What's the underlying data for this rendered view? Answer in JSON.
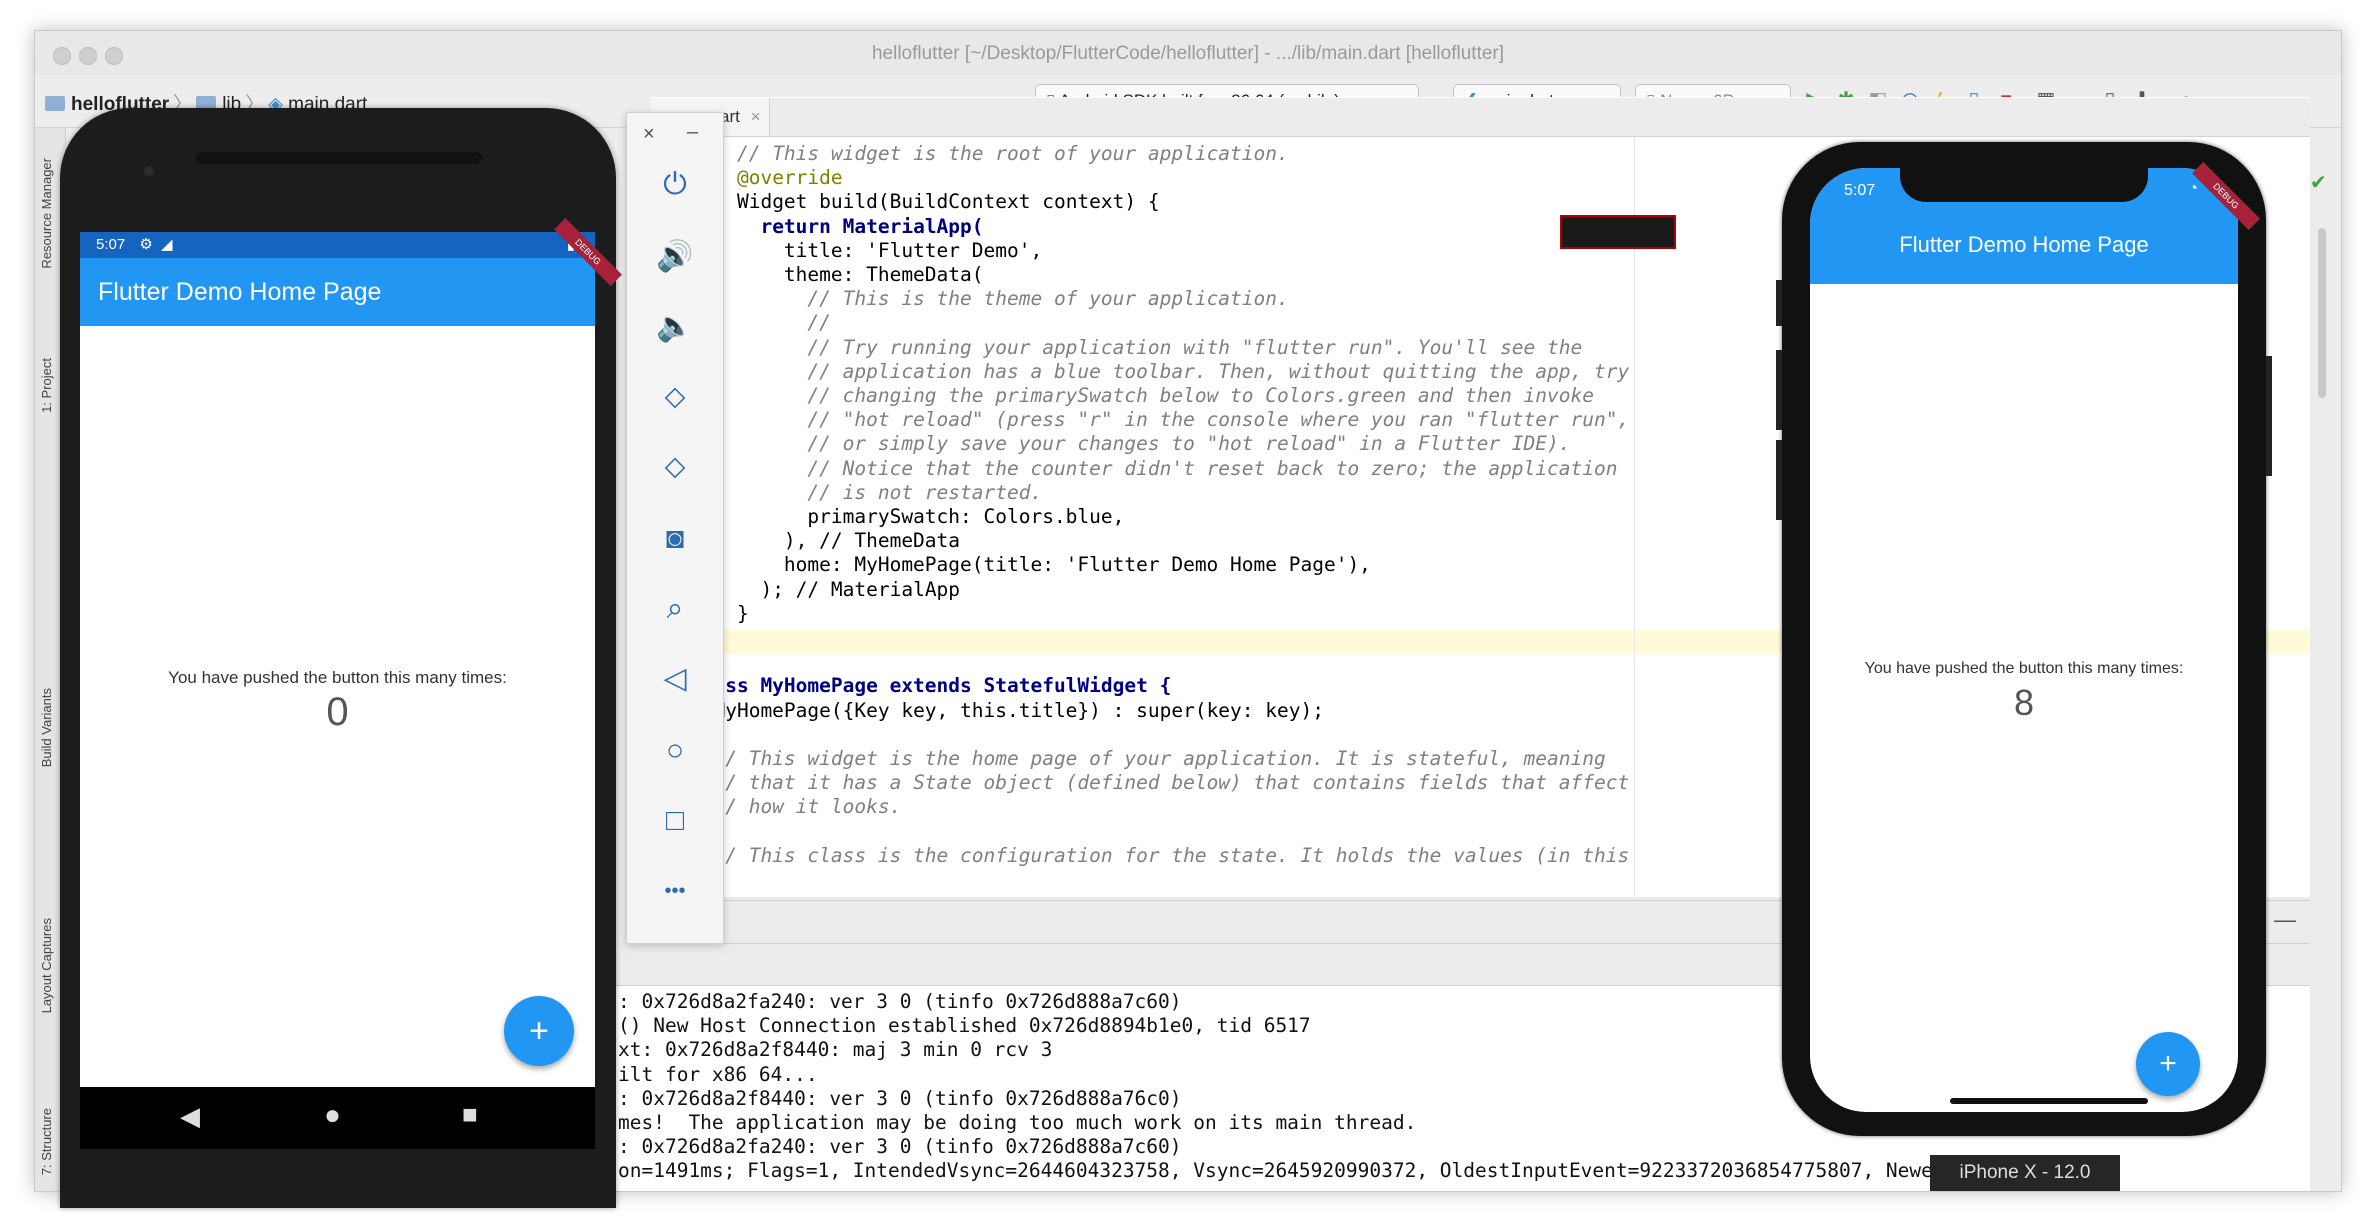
{
  "window": {
    "title": "helloflutter [~/Desktop/FlutterCode/helloflutter] - .../lib/main.dart [helloflutter]"
  },
  "breadcrumb": {
    "project": "helloflutter",
    "folder": "lib",
    "file": "main.dart"
  },
  "toolbar": {
    "device_selector": "Android SDK built for x86 64 (mobile)",
    "run_config": "main.dart",
    "avd_selector": "Nexus 6P"
  },
  "editor": {
    "tab_label": "art",
    "code_lines": [
      "// This widget is the root of your application.",
      "@override",
      "Widget build(BuildContext context) {",
      "return MaterialApp(",
      "title: 'Flutter Demo',",
      "theme: ThemeData(",
      "// This is the theme of your application.",
      "//",
      "// Try running your application with \"flutter run\". You'll see the",
      "// application has a blue toolbar. Then, without quitting the app, try",
      "// changing the primarySwatch below to Colors.green and then invoke",
      "// \"hot reload\" (press \"r\" in the console where you ran \"flutter run\",",
      "// or simply save your changes to \"hot reload\" in a Flutter IDE).",
      "// Notice that the counter didn't reset back to zero; the application",
      "// is not restarted.",
      "primarySwatch: Colors.blue,",
      "), // ThemeData",
      "home: MyHomePage(title: 'Flutter Demo Home Page'),",
      "); // MaterialApp",
      "}",
      "}",
      "",
      "class MyHomePage extends StatefulWidget {",
      "MyHomePage({Key key, this.title}) : super(key: key);",
      "",
      "// This widget is the home page of your application. It is stateful, meaning",
      "// that it has a State object (defined below) that contains fields that affect",
      "// how it looks.",
      "",
      "// This class is the configuration for the state. It holds the values (in this"
    ]
  },
  "left_strip": {
    "tabs": [
      "Resource Manager",
      "1: Project",
      "Build Variants",
      "Layout Captures",
      "7: Structure"
    ]
  },
  "logcat": {
    "lines": [
      ": 0x726d8a2fa240: ver 3 0 (tinfo 0x726d888a7c60)",
      "() New Host Connection established 0x726d8894b1e0, tid 6517",
      "xt: 0x726d8a2f8440: maj 3 min 0 rcv 3",
      "ilt for x86 64...",
      ": 0x726d8a2f8440: ver 3 0 (tinfo 0x726d888a76c0)",
      "mes!  The application may be doing too much work on its main thread.",
      ": 0x726d8a2fa240: ver 3 0 (tinfo 0x726d888a7c60)",
      "on=1491ms; Flags=1, IntendedVsync=2644604323758, Vsync=2645920990372, OldestInputEvent=9223372036854775807, NewestIn"
    ]
  },
  "android_emulator": {
    "status_time": "5:07",
    "app_title": "Flutter Demo Home Page",
    "counter_label": "You have pushed the button this many times:",
    "counter_value": "0",
    "fab_label": "+",
    "debug_ribbon": "DEBUG"
  },
  "ios_simulator": {
    "status_time": "5:07",
    "app_title": "Flutter Demo Home Page",
    "counter_label": "You have pushed the button this many times:",
    "counter_value": "8",
    "fab_label": "+",
    "debug_ribbon": "DEBUG",
    "device_label": "iPhone X - 12.0"
  },
  "emulator_toolbar": {
    "close_label": "×",
    "minimize_label": "–",
    "more_label": "•••"
  },
  "colors": {
    "flutter_blue": "#2196f3",
    "status_blue": "#1565c0",
    "editor_bg": "#ffffff"
  }
}
